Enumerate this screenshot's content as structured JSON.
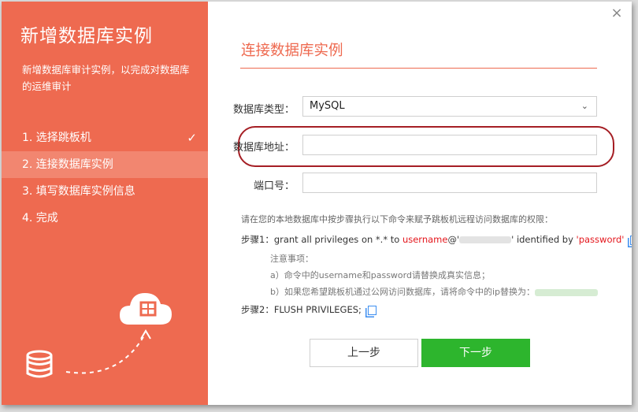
{
  "sidebar": {
    "title": "新增数据库实例",
    "description": "新增数据库审计实例，以完成对数据库的运维审计",
    "steps": [
      {
        "label": "1. 选择跳板机",
        "done": true
      },
      {
        "label": "2. 连接数据库实例",
        "active": true
      },
      {
        "label": "3. 填写数据库实例信息"
      },
      {
        "label": "4. 完成"
      }
    ],
    "check_glyph": "✓"
  },
  "dialog": {
    "close_glyph": "×"
  },
  "main": {
    "title": "连接数据库实例",
    "form": {
      "db_type_label": "数据库类型：",
      "db_type_value": "MySQL",
      "db_address_label": "数据库地址：",
      "db_address_value": "",
      "port_label": "端口号：",
      "port_value": ""
    },
    "info": "请在您的本地数据库中按步骤执行以下命令来赋予跳板机远程访问数据库的权限：",
    "step1": {
      "prefix": "步骤1：grant all privileges on *.* to ",
      "username": "username",
      "at": "@'",
      "quote_close": "' identified by ",
      "password": "'password'"
    },
    "notes_title": "注意事项：",
    "note_a": "a）命令中的username和password请替换成真实信息；",
    "note_b": "b）如果您希望跳板机通过公网访问数据库，请将命令中的ip替换为：",
    "step2": "步骤2：FLUSH PRIVILEGES;"
  },
  "buttons": {
    "prev": "上一步",
    "next": "下一步"
  },
  "colors": {
    "accent": "#ee6a50",
    "active_step": "#f28670",
    "next_button": "#2db52d",
    "highlight_ring": "#a51e24",
    "copy_icon": "#3c8ef0"
  }
}
